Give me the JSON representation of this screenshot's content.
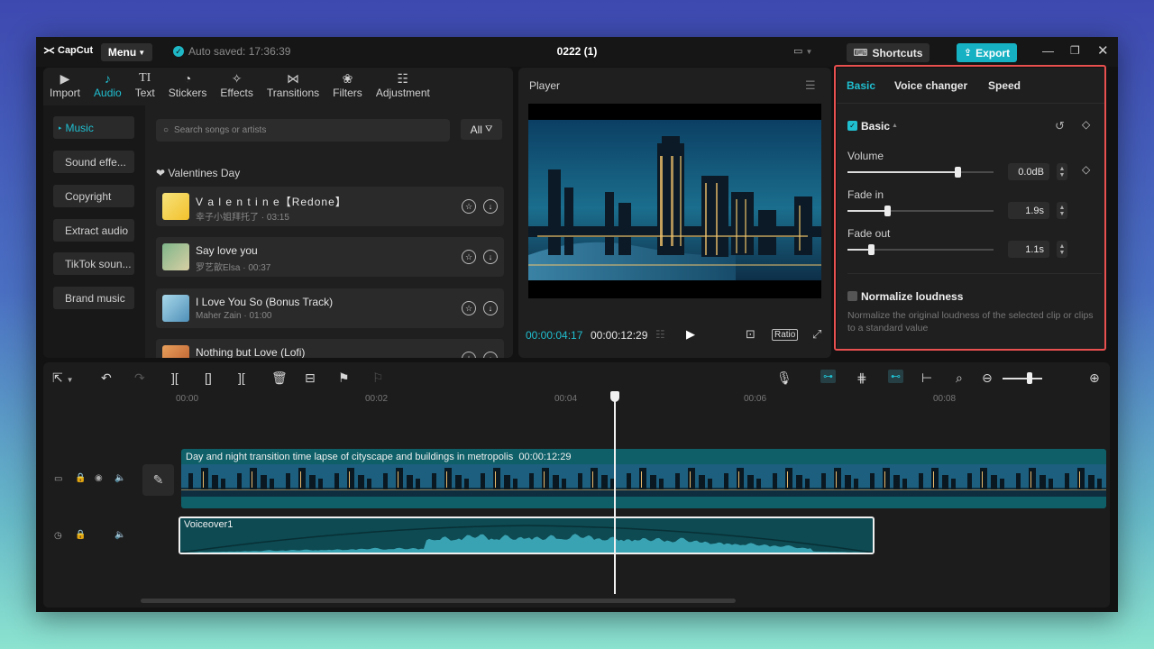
{
  "app": {
    "logo": "CapCut",
    "menu_label": "Menu",
    "autosave": "Auto saved: 17:36:39",
    "project_title": "0222 (1)",
    "shortcuts_label": "Shortcuts",
    "export_label": "Export"
  },
  "tabs": [
    {
      "label": "Import",
      "icon": "import-icon"
    },
    {
      "label": "Audio",
      "icon": "audio-icon"
    },
    {
      "label": "Text",
      "icon": "text-icon"
    },
    {
      "label": "Stickers",
      "icon": "stickers-icon"
    },
    {
      "label": "Effects",
      "icon": "effects-icon"
    },
    {
      "label": "Transitions",
      "icon": "transitions-icon"
    },
    {
      "label": "Filters",
      "icon": "filters-icon"
    },
    {
      "label": "Adjustment",
      "icon": "adjustment-icon"
    }
  ],
  "categories": [
    "Music",
    "Sound effe...",
    "Copyright",
    "Extract audio",
    "TikTok soun...",
    "Brand music"
  ],
  "search": {
    "placeholder": "Search songs or artists",
    "filter_label": "All"
  },
  "section_title": "Valentines Day",
  "songs": [
    {
      "title": "V a l e n t i n e【Redone】",
      "artist": "幸子小姐拜托了 · 03:15"
    },
    {
      "title": "Say love you",
      "artist": "罗艺歆Elsa · 00:37"
    },
    {
      "title": "I Love You So (Bonus Track)",
      "artist": "Maher Zain · 01:00"
    },
    {
      "title": "Nothing but Love (Lofi)",
      "artist": ""
    }
  ],
  "player": {
    "title": "Player",
    "current_time": "00:00:04:17",
    "total_time": "00:00:12:29",
    "ratio_label": "Ratio"
  },
  "right_panel": {
    "tabs": [
      "Basic",
      "Voice changer",
      "Speed"
    ],
    "section": "Basic",
    "volume": {
      "label": "Volume",
      "value": "0.0dB",
      "level": 0.75
    },
    "fade_in": {
      "label": "Fade in",
      "value": "1.9s",
      "level": 0.27
    },
    "fade_out": {
      "label": "Fade out",
      "value": "1.1s",
      "level": 0.16
    },
    "normalize": {
      "label": "Normalize loudness",
      "description": "Normalize the original loudness of the selected clip or clips to a standard value"
    }
  },
  "timeline": {
    "ruler": [
      "00:00",
      "00:02",
      "00:04",
      "00:06",
      "00:08"
    ],
    "video_clip": {
      "title": "Day and night transition time lapse of cityscape and buildings in metropolis",
      "duration": "00:00:12:29"
    },
    "audio_clip": {
      "label": "Voiceover1"
    }
  },
  "colors": {
    "accent": "#20bfd0",
    "highlight_border": "#e84f4f"
  }
}
